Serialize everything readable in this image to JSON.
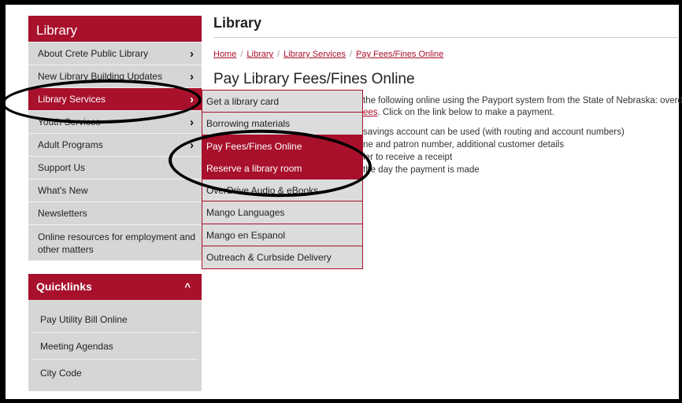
{
  "sidebar": {
    "heading": "Library",
    "items": [
      {
        "label": "About Crete Public Library",
        "chevron": "›"
      },
      {
        "label": "New Library Building Updates",
        "chevron": "›"
      },
      {
        "label": "Library Services",
        "chevron": "›"
      },
      {
        "label": "Youth Services",
        "chevron": "›"
      },
      {
        "label": "Adult Programs",
        "chevron": "›"
      },
      {
        "label": "Support Us"
      },
      {
        "label": "What's New"
      },
      {
        "label": "Newsletters"
      },
      {
        "label": "Online resources for employment and other matters"
      }
    ]
  },
  "quicklinks": {
    "heading": "Quicklinks",
    "caret": "^",
    "items": [
      "Pay Utility Bill Online",
      "Meeting Agendas",
      "City Code"
    ]
  },
  "main": {
    "title": "Library",
    "breadcrumb": [
      "Home",
      "Library",
      "Library Services",
      "Pay Fees/Fines Online"
    ],
    "breadcrumb_sep": "/",
    "heading": "Pay Library Fees/Fines Online",
    "intro_line1": "the following online using the Payport system from the State of Nebraska: overd",
    "intro_link": "ees",
    "intro_line2_rest": ". Click on the link below to make a payment.",
    "bullets": [
      "savings account can be used (with routing and account numbers)",
      "ne and patron number, additional customer details",
      "ler to receive a receipt",
      "the day the payment is made"
    ]
  },
  "dropdown": {
    "items": [
      "Get a library card",
      "Borrowing materials",
      "Pay Fees/Fines Online",
      "Reserve a library room",
      "OverDrive Audio & eBooks",
      "Mango Languages",
      "Mango en Espanol",
      "Outreach & Curbside Delivery"
    ]
  },
  "colors": {
    "accent": "#a8102b",
    "menu_bg": "#d6d6d6"
  }
}
